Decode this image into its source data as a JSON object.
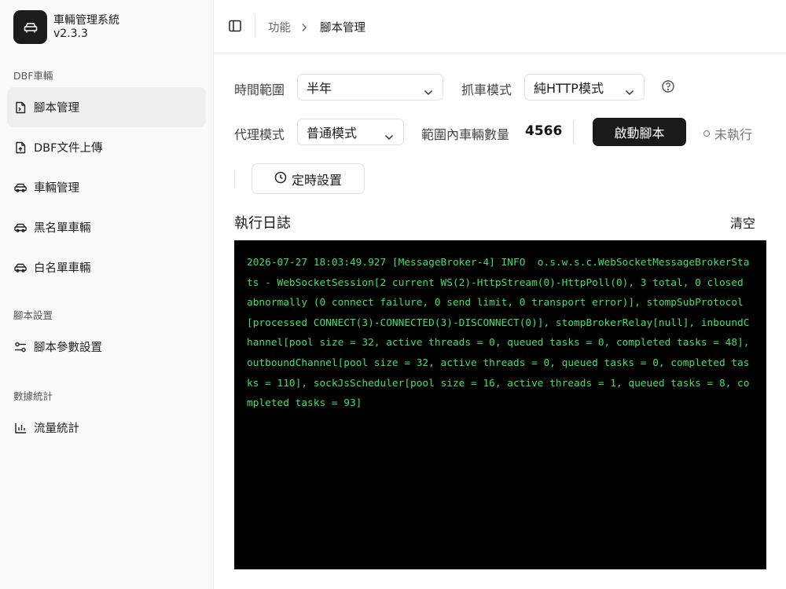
{
  "app": {
    "name": "車輛管理系統",
    "version": "v2.3.3",
    "logo_icon": "car-icon"
  },
  "sidebar": {
    "groups": [
      {
        "label": "DBF車輛"
      },
      {
        "label": "腳本設置"
      },
      {
        "label": "數據統計"
      }
    ],
    "items": [
      {
        "label": "腳本管理",
        "icon": "script-file-icon",
        "active": true
      },
      {
        "label": "DBF文件上傳",
        "icon": "file-upload-icon"
      },
      {
        "label": "車輛管理",
        "icon": "car-icon"
      },
      {
        "label": "黑名單車輛",
        "icon": "car-icon"
      },
      {
        "label": "白名單車輛",
        "icon": "car-icon"
      },
      {
        "label": "腳本參數設置",
        "icon": "sliders-icon"
      },
      {
        "label": "流量統計",
        "icon": "bar-chart-icon"
      }
    ]
  },
  "header": {
    "breadcrumb": [
      "功能",
      "腳本管理"
    ]
  },
  "controls": {
    "time_range": {
      "label": "時間範圍",
      "value": "半年"
    },
    "capture_mode": {
      "label": "抓車模式",
      "value": "純HTTP模式"
    },
    "proxy_mode": {
      "label": "代理模式",
      "value": "普通模式"
    },
    "vehicle_count": {
      "label": "範圍內車輛數量",
      "value": "4566"
    },
    "start_button": "啟動腳本",
    "status": "未執行",
    "timer_button": "定時設置"
  },
  "log": {
    "title": "執行日誌",
    "clear_label": "清空",
    "text": "2026-07-27 18:03:49.927 [MessageBroker-4] INFO  o.s.w.s.c.WebSocketMessageBrokerStats - WebSocketSession[2 current WS(2)-HttpStream(0)-HttpPoll(0), 3 total, 0 closed abnormally (0 connect failure, 0 send limit, 0 transport error)], stompSubProtocol[processed CONNECT(3)-CONNECTED(3)-DISCONNECT(0)], stompBrokerRelay[null], inboundChannel[pool size = 32, active threads = 0, queued tasks = 0, completed tasks = 48], outboundChannel[pool size = 32, active threads = 0, queued tasks = 0, completed tasks = 110], sockJsScheduler[pool size = 16, active threads = 1, queued tasks = 8, completed tasks = 93]",
    "text_color": "#3ee06b",
    "background": "#000000"
  }
}
